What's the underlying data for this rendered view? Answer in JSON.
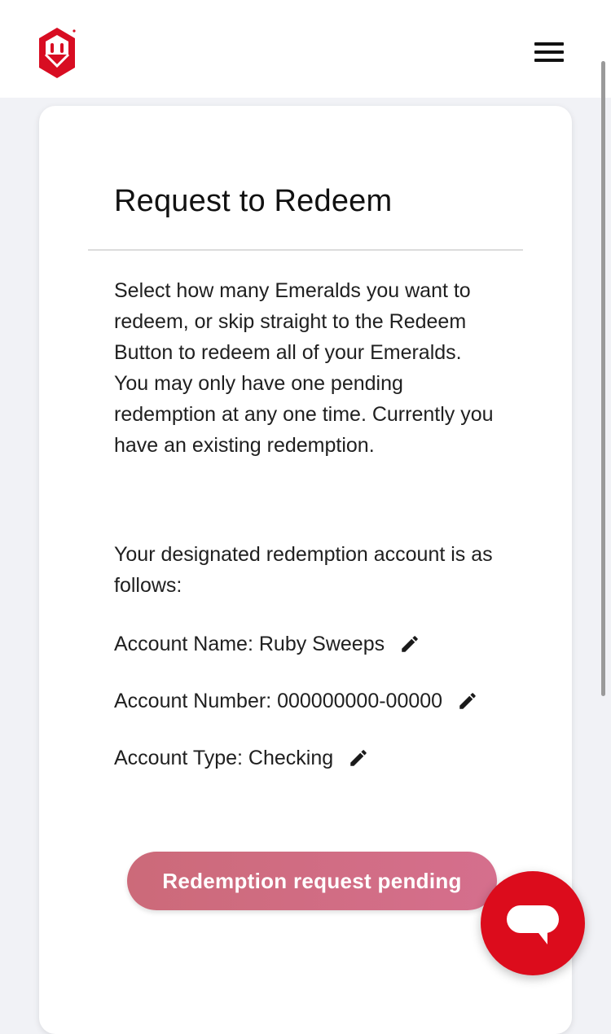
{
  "header": {
    "logo_icon": "ruby-shield-logo-icon",
    "menu_icon": "hamburger-menu-icon"
  },
  "card": {
    "title": "Request to Redeem",
    "description": "Select how many Emeralds you want to redeem, or skip straight to the Redeem Button to redeem all of your Emeralds. You may only have one pending redemption at any one time. Currently you have an existing redemption.",
    "account_intro": "Your designated redemption account is as follows:",
    "account": {
      "name": "Account Name: Ruby Sweeps",
      "number": "Account Number: 000000000-00000",
      "type": "Account Type: Checking",
      "edit_icon": "pencil-icon"
    },
    "pending_button_label": "Redemption request pending"
  },
  "chat": {
    "icon": "chat-bubble-icon"
  },
  "colors": {
    "brand_red": "#dc0c1c",
    "pending_button": "#cf6b80",
    "background": "#f1f2f6"
  }
}
